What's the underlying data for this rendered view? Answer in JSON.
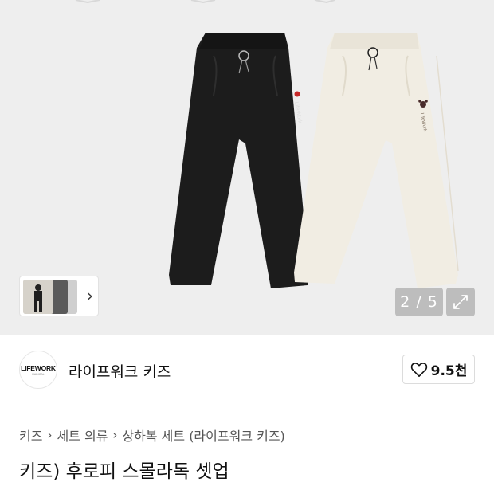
{
  "gallery": {
    "counter": "2 / 5",
    "thumbnail_chevron": "›",
    "expand_icon": "expand-icon"
  },
  "brand": {
    "logo_text": "LIFEWORK",
    "logo_subtext": "RADICAL",
    "name": "라이프워크 키즈",
    "like_count": "9.5천",
    "like_icon": "heart-outline-icon"
  },
  "breadcrumb": {
    "items": [
      "키즈",
      "세트 의류",
      "상하복 세트 (라이프워크 키즈)"
    ],
    "separator": "›"
  },
  "product": {
    "title": "키즈) 후로피 스몰라독 셋업",
    "embroidery_text": "LifeWork"
  },
  "colors": {
    "background": "#eeeeee",
    "black_pants": "#1c1c1c",
    "cream_pants": "#f1ede3",
    "text_primary": "#111111",
    "text_secondary": "#555555"
  }
}
